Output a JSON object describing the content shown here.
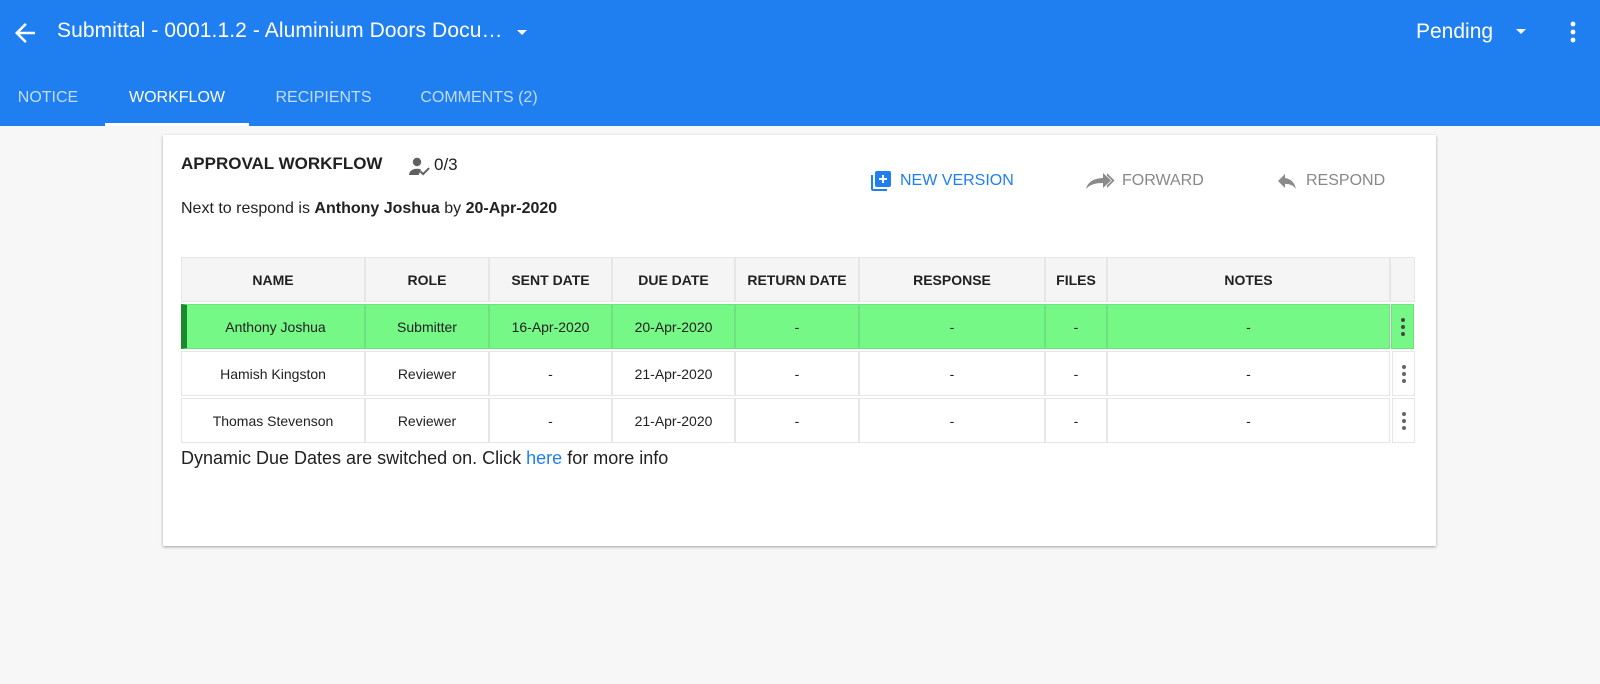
{
  "header": {
    "title": "Submittal - 0001.1.2 - Aluminium Doors Docu…",
    "status": "Pending"
  },
  "tabs": [
    {
      "label": "NOTICE"
    },
    {
      "label": "WORKFLOW"
    },
    {
      "label": "RECIPIENTS"
    },
    {
      "label": "COMMENTS (2)"
    }
  ],
  "workflow": {
    "title": "APPROVAL WORKFLOW",
    "approvals": "0/3",
    "next_prefix": "Next to respond is",
    "next_name": "Anthony Joshua",
    "next_by": "by",
    "next_date": "20-Apr-2020",
    "actions": {
      "new_version": "NEW VERSION",
      "forward": "FORWARD",
      "respond": "RESPOND"
    },
    "columns": [
      "NAME",
      "ROLE",
      "SENT DATE",
      "DUE DATE",
      "RETURN DATE",
      "RESPONSE",
      "FILES",
      "NOTES"
    ],
    "rows": [
      {
        "name": "Anthony Joshua",
        "role": "Submitter",
        "sent": "16-Apr-2020",
        "due": "20-Apr-2020",
        "returned": "-",
        "response": "-",
        "files": "-",
        "notes": "-"
      },
      {
        "name": "Hamish Kingston",
        "role": "Reviewer",
        "sent": "-",
        "due": "21-Apr-2020",
        "returned": "-",
        "response": "-",
        "files": "-",
        "notes": "-"
      },
      {
        "name": "Thomas Stevenson",
        "role": "Reviewer",
        "sent": "-",
        "due": "21-Apr-2020",
        "returned": "-",
        "response": "-",
        "files": "-",
        "notes": "-"
      }
    ],
    "footnote_before": "Dynamic Due Dates are switched on. Click",
    "footnote_link": "here",
    "footnote_after": "for more info"
  },
  "colors": {
    "primary": "#1f7ff0",
    "active_row": "#76f887",
    "active_row_marker": "#1a8a2a"
  },
  "icons": {
    "back": "arrow-left-icon",
    "title_menu": "caret-down-icon",
    "status_menu": "caret-down-icon",
    "more": "more-vertical-icon",
    "approver": "person-check-icon",
    "new_version": "add-box-icon",
    "forward": "forward-icon",
    "respond": "reply-icon",
    "row_menu": "more-vertical-icon"
  }
}
